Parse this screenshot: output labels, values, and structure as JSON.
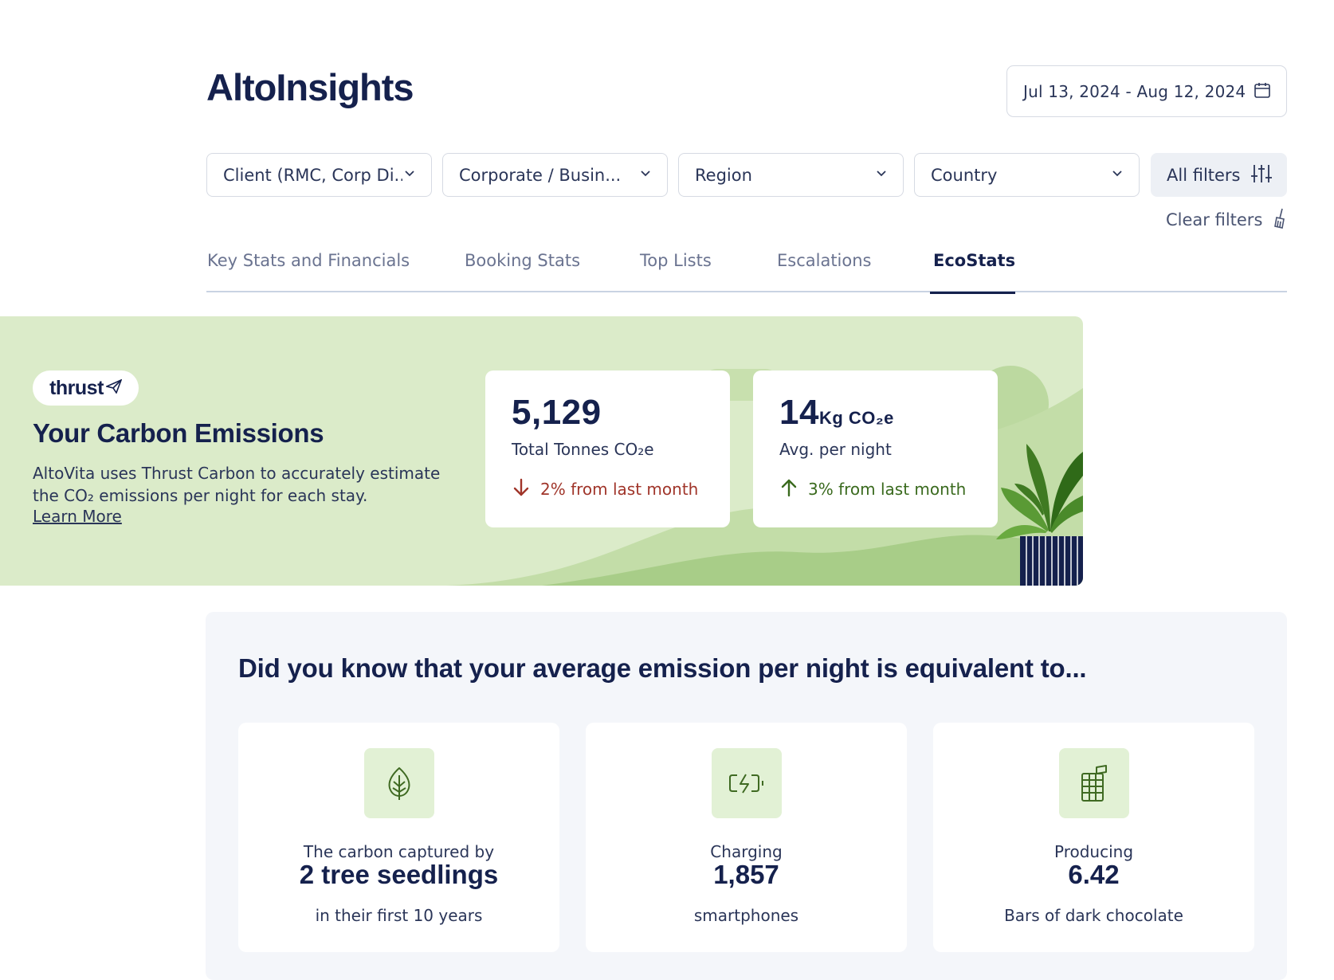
{
  "header": {
    "title": "AltoInsights",
    "date_range": "Jul 13, 2024 - Aug 12, 2024"
  },
  "filters": [
    {
      "label": "Client (RMC, Corp Di..."
    },
    {
      "label": "Corporate / Busin..."
    },
    {
      "label": "Region"
    },
    {
      "label": "Country"
    }
  ],
  "all_filters_label": "All filters",
  "clear_filters_label": "Clear filters",
  "tabs": [
    {
      "label": "Key Stats and Financials",
      "active": false
    },
    {
      "label": "Booking Stats",
      "active": false
    },
    {
      "label": "Top Lists",
      "active": false
    },
    {
      "label": "Escalations",
      "active": false
    },
    {
      "label": "EcoStats",
      "active": true
    }
  ],
  "banner": {
    "logo_text": "thrust",
    "title": "Your Carbon Emissions",
    "desc_line1": "AltoVita uses Thrust Carbon to accurately estimate",
    "desc_line2": "the CO₂ emissions per night for each stay.",
    "learn_more": "Learn More",
    "background_color": "#dbebc9"
  },
  "stats": [
    {
      "value": "5,129",
      "unit": "",
      "label": "Total Tonnes CO₂e",
      "change": "2% from last month",
      "direction": "down"
    },
    {
      "value": "14",
      "unit": "Kg CO₂e",
      "label": "Avg. per night",
      "change": "3% from last month",
      "direction": "up"
    }
  ],
  "equivalents": {
    "title": "Did you know that your average emission per night is equivalent to...",
    "items": [
      {
        "icon": "leaf-icon",
        "pre": "The carbon captured by",
        "value": "2 tree seedlings",
        "post": "in their first 10 years"
      },
      {
        "icon": "battery-charging-icon",
        "pre": "Charging",
        "value": "1,857",
        "post": "smartphones"
      },
      {
        "icon": "chocolate-bar-icon",
        "pre": "Producing",
        "value": "6.42",
        "post": "Bars of dark chocolate"
      }
    ]
  },
  "colors": {
    "navy": "#15214d",
    "change_down": "#a0352a",
    "change_up": "#3a6a1e",
    "icon_tile": "#e2f1d5",
    "icon_green": "#3f6a22"
  }
}
